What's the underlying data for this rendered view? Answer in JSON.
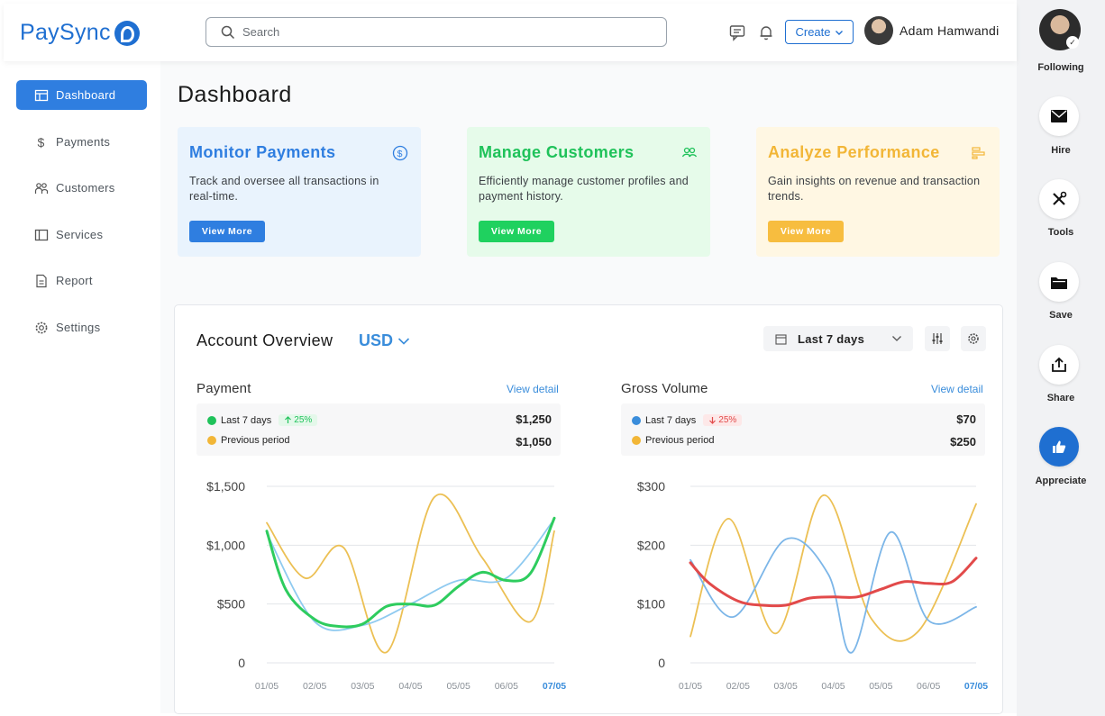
{
  "brand": {
    "name": "PaySync"
  },
  "search": {
    "placeholder": "Search"
  },
  "header": {
    "create_label": "Create",
    "user_name": "Adam Hamwandi"
  },
  "sidebar": {
    "items": [
      {
        "label": "Dashboard",
        "icon": "layout-icon",
        "active": true
      },
      {
        "label": "Payments",
        "icon": "dollar-icon"
      },
      {
        "label": "Customers",
        "icon": "users-icon"
      },
      {
        "label": "Services",
        "icon": "panel-icon"
      },
      {
        "label": "Report",
        "icon": "document-icon"
      },
      {
        "label": "Settings",
        "icon": "gear-icon"
      }
    ]
  },
  "page": {
    "title": "Dashboard"
  },
  "cards": [
    {
      "title": "Monitor Payments",
      "desc": "Track and oversee all transactions in real-time.",
      "button": "View More",
      "color": "#2f7ee0",
      "bg": "#e9f3fd",
      "title_color": "#2f7ee0",
      "icon": "dollar-circle-icon"
    },
    {
      "title": "Manage Customers",
      "desc": "Efficiently manage customer profiles and payment history.",
      "button": "View More",
      "color": "#1fd15f",
      "bg": "#e6fbea",
      "title_color": "#1fc25a",
      "icon": "users-icon"
    },
    {
      "title": "Analyze Performance",
      "desc": "Gain insights on revenue and transaction trends.",
      "button": "View More",
      "color": "#f7bd3f",
      "bg": "#fff7e3",
      "title_color": "#f2b637",
      "icon": "bar-chart-icon"
    }
  ],
  "overview": {
    "title": "Account Overview",
    "currency": "USD",
    "range": "Last 7 days"
  },
  "panels": [
    {
      "title": "Payment",
      "view_detail": "View detail",
      "current_label": "Last 7 days",
      "current_change": "25%",
      "current_value": "$1,250",
      "current_color": "#1fc25a",
      "previous_label": "Previous period",
      "previous_value": "$1,050",
      "previous_color": "#f2b637"
    },
    {
      "title": "Gross Volume",
      "view_detail": "View detail",
      "current_label": "Last 7 days",
      "current_change": "25%",
      "current_value": "$70",
      "current_color": "#3a8ddb",
      "previous_label": "Previous period",
      "previous_value": "$250",
      "previous_color": "#f2b637"
    }
  ],
  "chart_data": [
    {
      "type": "line",
      "title": "Payment",
      "categories": [
        "01/05",
        "02/05",
        "03/05",
        "04/05",
        "05/05",
        "06/05",
        "07/05"
      ],
      "y_ticks": [
        "$1,500",
        "$1,000",
        "$500",
        "0"
      ],
      "ylim": [
        0,
        1500
      ],
      "grid": true,
      "highlight_category": "07/05",
      "series": [
        {
          "color": "#ecc054",
          "x": [
            0,
            0.8,
            1.6,
            2.5,
            3.5,
            4.5,
            5.5,
            6
          ],
          "values": [
            1190,
            720,
            980,
            90,
            1410,
            890,
            350,
            1120
          ]
        },
        {
          "color": "#8fcaf0",
          "x": [
            0,
            1,
            2,
            3,
            4,
            5,
            6
          ],
          "values": [
            1100,
            350,
            320,
            500,
            700,
            720,
            1220
          ]
        },
        {
          "color": "#2ecc5e",
          "x": [
            0,
            0.4,
            1,
            1.5,
            2,
            2.5,
            3,
            3.5,
            4,
            4.5,
            5,
            5.5,
            6
          ],
          "values": [
            1120,
            620,
            370,
            310,
            330,
            480,
            500,
            490,
            650,
            770,
            700,
            760,
            1230
          ]
        }
      ]
    },
    {
      "type": "line",
      "title": "Gross Volume",
      "categories": [
        "01/05",
        "02/05",
        "03/05",
        "04/05",
        "05/05",
        "06/05",
        "07/05"
      ],
      "y_ticks": [
        "$300",
        "$200",
        "$100",
        "0"
      ],
      "ylim": [
        0,
        300
      ],
      "grid": true,
      "highlight_category": "07/05",
      "series": [
        {
          "color": "#ecc054",
          "x": [
            0,
            0.8,
            1.8,
            2.8,
            3.8,
            4.8,
            6
          ],
          "values": [
            45,
            245,
            50,
            285,
            75,
            55,
            270
          ]
        },
        {
          "color": "#7cb6e8",
          "x": [
            0,
            0.9,
            2,
            2.9,
            3.4,
            4.2,
            5,
            6
          ],
          "values": [
            175,
            78,
            210,
            150,
            18,
            222,
            72,
            95
          ]
        },
        {
          "color": "#e24a4a",
          "x": [
            0,
            0.4,
            1,
            1.5,
            2,
            2.5,
            3,
            3.5,
            4,
            4.5,
            5,
            5.5,
            6
          ],
          "values": [
            170,
            135,
            105,
            98,
            98,
            110,
            112,
            112,
            125,
            138,
            135,
            138,
            178
          ]
        }
      ]
    }
  ],
  "right_rail": {
    "items": [
      {
        "label": "Following"
      },
      {
        "label": "Hire",
        "icon": "mail-icon"
      },
      {
        "label": "Tools",
        "icon": "tools-icon"
      },
      {
        "label": "Save",
        "icon": "folder-icon"
      },
      {
        "label": "Share",
        "icon": "share-icon"
      },
      {
        "label": "Appreciate",
        "icon": "thumbs-up-icon"
      }
    ]
  }
}
